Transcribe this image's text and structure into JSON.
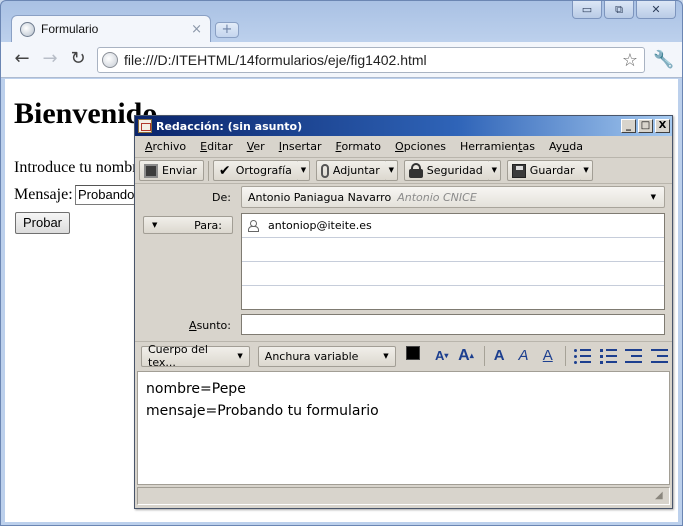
{
  "browser": {
    "tab_title": "Formulario",
    "tab_close": "×",
    "new_tab": "+",
    "url": "file:///D:/ITEHTML/14formularios/eje/fig1402.html",
    "back": "←",
    "forward": "→",
    "reload": "↻",
    "star": "☆",
    "wrench": "🔧",
    "window_controls": {
      "minimize": "▭",
      "maximize": "⧉",
      "close": "✕"
    }
  },
  "page": {
    "heading": "Bienvenido",
    "intro": "Introduce tu nombre",
    "mensaje_label": "Mensaje:",
    "mensaje_value": "Probando tu formulario",
    "submit": "Probar"
  },
  "compose": {
    "title": "Redacción: (sin asunto)",
    "window_controls": {
      "minimize": "_",
      "maximize": "□",
      "close": "X"
    },
    "menu": [
      {
        "acc": "A",
        "rest": "rchivo"
      },
      {
        "acc": "E",
        "rest": "ditar"
      },
      {
        "acc": "V",
        "rest": "er"
      },
      {
        "acc": "I",
        "rest": "nsertar"
      },
      {
        "acc": "F",
        "rest": "ormato"
      },
      {
        "acc": "O",
        "rest": "pciones"
      },
      {
        "pre": "Herramien",
        "acc": "t",
        "rest": "as"
      },
      {
        "pre": "Ay",
        "acc": "u",
        "rest": "da"
      }
    ],
    "toolbar": {
      "send": "Enviar",
      "spelling": "Ortografía",
      "attach": "Adjuntar",
      "security": "Seguridad",
      "save": "Guardar"
    },
    "from_label": "De:",
    "from_name": "Antonio Paniagua Navarro",
    "from_hint": "Antonio CNICE",
    "to_label": "Para:",
    "recipients": [
      "antoniop@iteite.es",
      "",
      "",
      ""
    ],
    "subject_label": "Asunto:",
    "subject_value": "",
    "format": {
      "paragraph": "Cuerpo del tex...",
      "font": "Anchura variable",
      "smaller": "A",
      "larger": "A",
      "bold": "A",
      "italic": "A",
      "underline": "A",
      "text_color": "#000000",
      "background_color": "#ffffff"
    },
    "body_lines": [
      "nombre=Pepe",
      "mensaje=Probando tu formulario"
    ],
    "resize_grip": "◢"
  }
}
